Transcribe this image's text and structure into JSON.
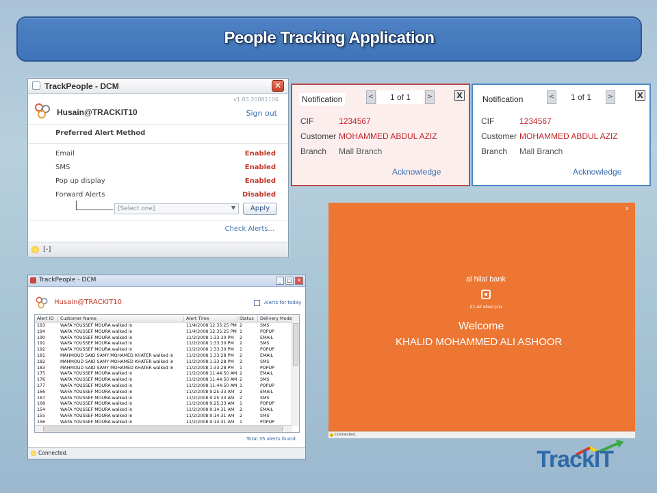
{
  "banner": {
    "title": "People Tracking Application"
  },
  "settings_window": {
    "title": "TrackPeople - DCM",
    "close_glyph": "✕",
    "version": "v1.03.20081106",
    "user": "Husain@TRACKIT10",
    "sign_out": "Sign out",
    "preferred_heading": "Preferred Alert Method",
    "methods": [
      {
        "label": "Email",
        "value": "Enabled"
      },
      {
        "label": "SMS",
        "value": "Enabled"
      },
      {
        "label": "Pop up display",
        "value": "Enabled"
      },
      {
        "label": "Forward Alerts",
        "value": "Disabled"
      }
    ],
    "select_placeholder": "[Select one]",
    "apply": "Apply",
    "check_alerts": "Check Alerts...",
    "status": "[-]"
  },
  "notifications": [
    {
      "title": "Notification",
      "page": "1 of 1",
      "prev": "<",
      "next": ">",
      "close": "X",
      "fields": [
        {
          "label": "CIF",
          "value": "1234567"
        },
        {
          "label": "Customer",
          "value": "MOHAMMED ABDUL AZIZ"
        },
        {
          "label": "Branch",
          "value": "Mall Branch"
        }
      ],
      "acknowledge": "Acknowledge",
      "border_color": "#b84a4a"
    },
    {
      "title": "Notification",
      "page": "1 of 1",
      "prev": "<",
      "next": ">",
      "close": "X",
      "fields": [
        {
          "label": "CIF",
          "value": "1234567"
        },
        {
          "label": "Customer",
          "value": "MOHAMMED ABDUL AZIZ"
        },
        {
          "label": "Branch",
          "value": "Mall Branch"
        }
      ],
      "acknowledge": "Acknowledge",
      "border_color": "#4f86c6"
    }
  ],
  "alerts_window": {
    "title": "TrackPeople - DCM",
    "user": "Husain@TRACKIT10",
    "alerts_for_today": "Alerts for today",
    "columns": [
      "Alert ID",
      "Customer Name",
      "Alert Time",
      "Status",
      "Delivery Mode"
    ],
    "rows": [
      [
        "193",
        "WAFA YOUSSEF MOURA  walked in",
        "11/4/2008 12:35:25 PM",
        "2",
        "SMS"
      ],
      [
        "194",
        "WAFA YOUSSEF MOURA  walked in",
        "11/4/2008 12:35:25 PM",
        "1",
        "POPUP"
      ],
      [
        "190",
        "WAFA YOUSSEF MOURA  walked in",
        "11/2/2008 1:33:30 PM",
        "2",
        "EMAIL"
      ],
      [
        "191",
        "WAFA YOUSSEF MOURA  walked in",
        "11/2/2008 1:33:30 PM",
        "2",
        "SMS"
      ],
      [
        "192",
        "WAFA YOUSSEF MOURA  walked in",
        "11/2/2008 1:33:30 PM",
        "1",
        "POPUP"
      ],
      [
        "181",
        "MAHMOUD SAID SAMY MOHAMED KHATER  walked in",
        "11/2/2008 1:33:28 PM",
        "2",
        "EMAIL"
      ],
      [
        "182",
        "MAHMOUD SAID SAMY MOHAMED KHATER  walked in",
        "11/2/2008 1:33:28 PM",
        "2",
        "SMS"
      ],
      [
        "183",
        "MAHMOUD SAID SAMY MOHAMED KHATER  walked in",
        "11/2/2008 1:33:28 PM",
        "1",
        "POPUP"
      ],
      [
        "175",
        "WAFA YOUSSEF MOURA  walked in",
        "11/2/2008 11:44:50 AM",
        "2",
        "EMAIL"
      ],
      [
        "176",
        "WAFA YOUSSEF MOURA  walked in",
        "11/2/2008 11:44:50 AM",
        "2",
        "SMS"
      ],
      [
        "177",
        "WAFA YOUSSEF MOURA  walked in",
        "11/2/2008 11:44:50 AM",
        "1",
        "POPUP"
      ],
      [
        "166",
        "WAFA YOUSSEF MOURA  walked in",
        "11/2/2008 9:25:33 AM",
        "2",
        "EMAIL"
      ],
      [
        "167",
        "WAFA YOUSSEF MOURA  walked in",
        "11/2/2008 9:25:33 AM",
        "2",
        "SMS"
      ],
      [
        "168",
        "WAFA YOUSSEF MOURA  walked in",
        "11/2/2008 9:25:33 AM",
        "1",
        "POPUP"
      ],
      [
        "154",
        "WAFA YOUSSEF MOURA  walked in",
        "11/2/2008 9:14:31 AM",
        "2",
        "EMAIL"
      ],
      [
        "155",
        "WAFA YOUSSEF MOURA  walked in",
        "11/2/2008 9:14:31 AM",
        "2",
        "SMS"
      ],
      [
        "156",
        "WAFA YOUSSEF MOURA  walked in",
        "11/2/2008 9:14:31 AM",
        "1",
        "POPUP"
      ]
    ],
    "total": "Total 35 alerts found.",
    "status": "Connected."
  },
  "welcome_popup": {
    "close": "x",
    "bank": "al hilal bank",
    "tagline": "it's all about you",
    "welcome": "Welcome",
    "customer": "KHALID MOHAMMED ALI ASHOOR",
    "status": "Connected.",
    "background": "#ed7633"
  },
  "brand": {
    "logo_text": "TrackIT"
  }
}
